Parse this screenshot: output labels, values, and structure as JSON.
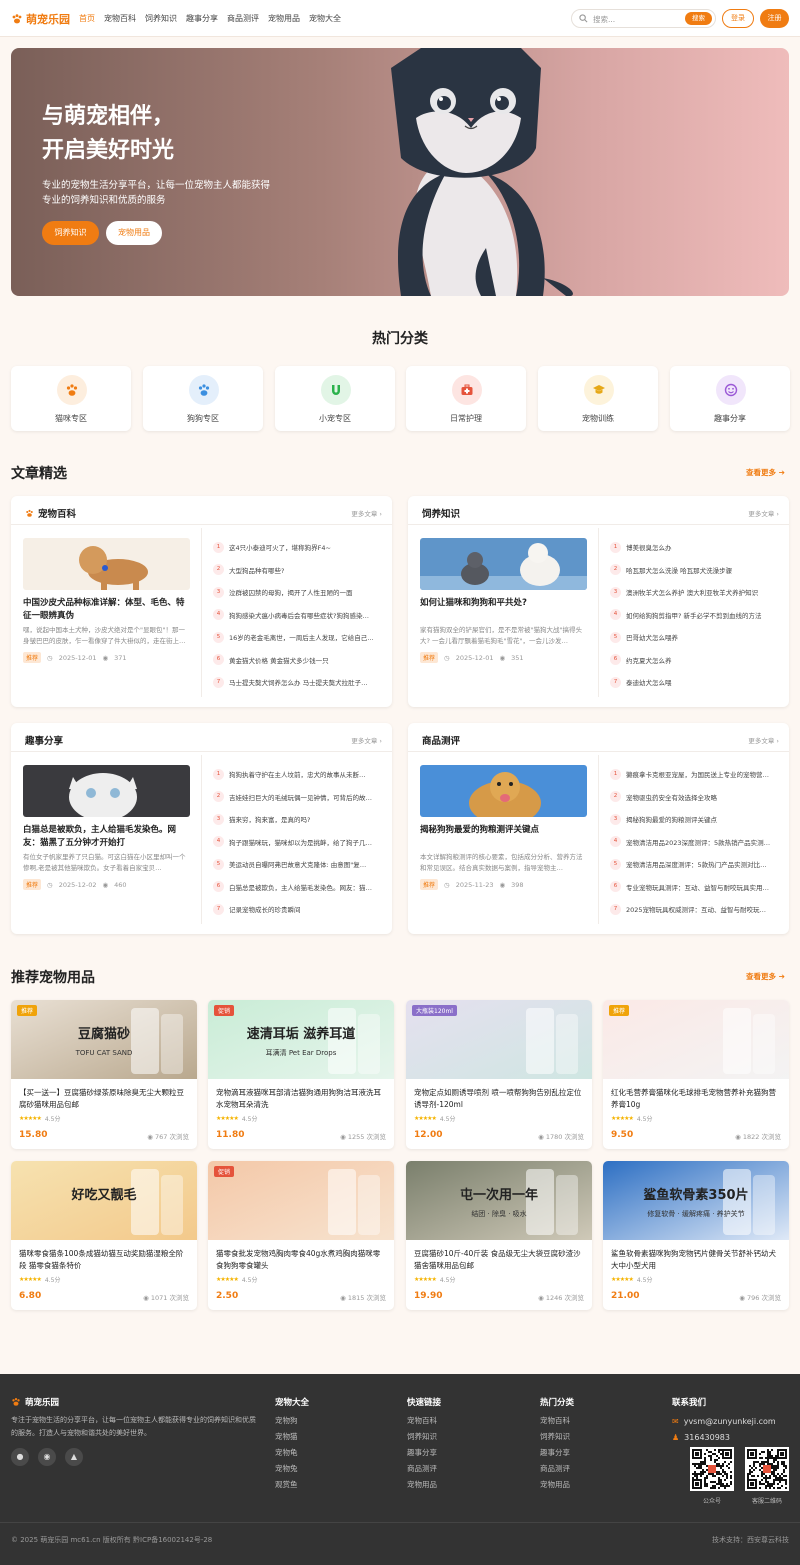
{
  "header": {
    "logo": "萌宠乐园",
    "nav": [
      "首页",
      "宠物百科",
      "饲养知识",
      "趣事分享",
      "商品测评",
      "宠物用品",
      "宠物大全"
    ],
    "search_placeholder": "搜索...",
    "search_button": "搜索",
    "login": "登录",
    "register": "注册"
  },
  "hero": {
    "title_line1": "与萌宠相伴，",
    "title_line2": "开启美好时光",
    "desc": "专业的宠物生活分享平台，让每一位宠物主人都能获得专业的饲养知识和优质的服务",
    "btn1": "饲养知识",
    "btn2": "宠物用品"
  },
  "categories": {
    "title": "热门分类",
    "items": [
      {
        "label": "猫咪专区",
        "icon": "paw-icon",
        "color": "#f07c12",
        "bg": "#fdeede"
      },
      {
        "label": "狗狗专区",
        "icon": "paw-icon",
        "color": "#3b8fe0",
        "bg": "#e4effb"
      },
      {
        "label": "小宠专区",
        "icon": "magnet-icon",
        "color": "#2bb24c",
        "bg": "#e2f5e6"
      },
      {
        "label": "日常护理",
        "icon": "medkit-icon",
        "color": "#e5533b",
        "bg": "#fde5e2"
      },
      {
        "label": "宠物训练",
        "icon": "graduation-icon",
        "color": "#e6a817",
        "bg": "#fdf3db"
      },
      {
        "label": "趣事分享",
        "icon": "smile-icon",
        "color": "#9b59d6",
        "bg": "#f1e6fb"
      }
    ]
  },
  "articles": {
    "title": "文章精选",
    "more": "查看更多",
    "panels": [
      {
        "title": "宠物百科",
        "more": "更多文章",
        "feature": {
          "title": "中国沙皮犬品种标准详解：体型、毛色、特征一眼辨真伪",
          "excerpt": "嘿，说起中国本土犬种，沙皮犬绝对是个\"显眼包\"！那一身皱巴巴的皮肤，乍一看像穿了件大褂似的，走在街上…",
          "tag": "推荐",
          "date": "2025-12-01",
          "views": "371"
        },
        "list": [
          "这4只小泰迪可火了，堪称狗界F4~",
          "大型狗品种有哪些?",
          "泣群被囚禁的母狗，揭开了人性丑陋的一面",
          "狗狗感染犬瘟小病毒后会有哪些症状?狗狗感染…",
          "16岁的老金毛离世，一周后主人发现，它给自己…",
          "黄金猫犬价格 黄金猫犬多少钱一只",
          "马士提夫獒犬饲养怎么办 马士提夫獒犬拉肚子…"
        ]
      },
      {
        "title": "饲养知识",
        "more": "更多文章",
        "feature": {
          "title": "如何让猫咪和狗狗和平共处?",
          "excerpt": "家有猫狗双全的铲屎官们，是不是常被\"猫狗大战\"搞得头大? 一会儿看厅飘着猫毛狗毛\"雪花\"，一会儿沙发…",
          "tag": "推荐",
          "date": "2025-12-01",
          "views": "351"
        },
        "list": [
          "博美很臭怎么办",
          "哈瓦那犬怎么洗澡 哈瓦那犬洗澡步骤",
          "澳洲牧羊犬怎么养护 澳大利亚牧羊犬养护知识",
          "如何给狗狗剪指甲? 新手必学不剪到血线的方法",
          "巴哥幼犬怎么喂养",
          "约克夏犬怎么养",
          "泰迪幼犬怎么喂"
        ]
      },
      {
        "title": "趣事分享",
        "more": "更多文章",
        "feature": {
          "title": "白猫总是被欺负，主人给猫毛发染色。网友：猫黑了五分钟才开始打",
          "excerpt": "有位女子帆家里养了只白猫。可这白猫在小区里却叫一个惨啊,老是被其他猫咪欺负。女子看着自家宝贝…",
          "tag": "推荐",
          "date": "2025-12-02",
          "views": "460"
        },
        "list": [
          "狗狗执着守护在主人坟前，忠犬的故事从未断…",
          "吉娃娃扫巨大的毛绒玩偶一见钟情，可背后的故…",
          "猫来穷，狗来富，是真的吗?",
          "狗子跟猫咪玩，猫咪却以为是挑衅，给了狗子几…",
          "美运动员自曝阿弗巴故意犬克隆体: 由意图\"复…",
          "白猫总是被欺负，主人给猫毛发染色。网友：猫…",
          "记录宠物成长的珍贵瞬间"
        ]
      },
      {
        "title": "商品测评",
        "more": "更多文章",
        "feature": {
          "title": "揭秘狗狗最爱的狗粮测评关键点",
          "excerpt": "本文详解狗粮测评的核心要素，包括成分分析、营养方法和常见误区。结合真实数据与案例，指导宠物主…",
          "tag": "推荐",
          "date": "2025-11-23",
          "views": "398"
        },
        "list": [
          "獭痕拿卡克根亚宠屋，为国民送上专业的宠物营…",
          "宠物驱虫药安全有效选择全攻略",
          "揭秘狗狗最爱的狗粮测评关键点",
          "宠物清洁用品2023深度测评：5款热销产品实测…",
          "宠物清洁用品深度测评：5款热门产品实测对比…",
          "专业宠物玩具测评：互动、益智与耐咬玩具实用…",
          "2025宠物玩具权威测评：互动、益智与耐咬玩…"
        ]
      }
    ]
  },
  "products": {
    "title": "推荐宠物用品",
    "more": "查看更多",
    "items": [
      {
        "name": "【买一送一】豆腐猫砂绿茶原味除臭无尘大颗粒豆腐砂猫咪用品包邮",
        "rating": "4.5分",
        "price": "15.80",
        "views": "767 次浏览",
        "badge": "推荐",
        "badge_color": "#f0a30a",
        "img_text": "豆腐猫砂",
        "img_sub": "TOFU CAT SAND",
        "bg1": "#e9e0d4",
        "bg2": "#b9a88e"
      },
      {
        "name": "宠物滴耳液猫咪耳部清洁猫狗通用狗狗洁耳液洗耳水宠物耳朵清洗",
        "rating": "4.5分",
        "price": "11.80",
        "views": "1255 次浏览",
        "badge": "促销",
        "badge_color": "#e5533b",
        "img_text": "速清耳垢 滋养耳道",
        "img_sub": "耳满清 Pet Ear Drops",
        "bg1": "#c9ecd6",
        "bg2": "#e6f5ec"
      },
      {
        "name": "宠物定点如厕诱导喷剂 喷一喷帮狗狗告别乱拉定位诱导剂-120ml",
        "rating": "4.5分",
        "price": "12.00",
        "views": "1780 次浏览",
        "badge": "大瓶装120ml",
        "badge_color": "#8a6fc9",
        "img_text": "",
        "img_sub": "",
        "bg1": "#e5e0ef",
        "bg2": "#cfe6e2"
      },
      {
        "name": "红化毛营养膏猫咪化毛球排毛宠物营养补充猫狗营养膏10g",
        "rating": "4.5分",
        "price": "9.50",
        "views": "1822 次浏览",
        "badge": "推荐",
        "badge_color": "#f0a30a",
        "img_text": "",
        "img_sub": "",
        "bg1": "#fbe9e6",
        "bg2": "#f3f3f3"
      },
      {
        "name": "猫咪零食猫条100条成猫幼猫互动奖励猫湿粮全阶段 猫零食猫条特价",
        "rating": "4.5分",
        "price": "6.80",
        "views": "1071 次浏览",
        "badge": "",
        "badge_color": "#f0a30a",
        "img_text": "好吃又靓毛",
        "img_sub": "",
        "bg1": "#f6e2b0",
        "bg2": "#f3c98b"
      },
      {
        "name": "猫零食批发宠物鸡胸肉零食40g水煮鸡胸肉猫咪零食狗狗零食罐头",
        "rating": "4.5分",
        "price": "2.50",
        "views": "1815 次浏览",
        "badge": "促销",
        "badge_color": "#e5533b",
        "img_text": "",
        "img_sub": "",
        "bg1": "#f4c8a8",
        "bg2": "#f7e3cf"
      },
      {
        "name": "豆腐猫砂10斤-40斤装 食品级无尘大袋豆腐砂渣沙猫舍猫咪用品包邮",
        "rating": "4.5分",
        "price": "19.90",
        "views": "1246 次浏览",
        "badge": "",
        "badge_color": "#f0a30a",
        "img_text": "屯一次用一年",
        "img_sub": "结团 · 除臭 · 吸水",
        "bg1": "#7a7f6c",
        "bg2": "#cfc9b8"
      },
      {
        "name": "鲨鱼软骨素猫咪狗狗宠物钙片健骨关节舒补钙幼犬大中小型犬用",
        "rating": "4.5分",
        "price": "21.00",
        "views": "796 次浏览",
        "badge": "",
        "badge_color": "#f0a30a",
        "img_text": "鲨鱼软骨素350片",
        "img_sub": "修复软骨 · 缓解疼痛 · 养护关节",
        "bg1": "#2d6fc3",
        "bg2": "#dfe9f7"
      }
    ]
  },
  "footer": {
    "logo": "萌宠乐园",
    "desc": "专注于宠物生活的分享平台，让每一位宠物主人都能获得专业的饲养知识和优质的服务。打造人与宠物和谐共处的美好世界。",
    "cols": [
      {
        "title": "宠物大全",
        "links": [
          "宠物狗",
          "宠物猫",
          "宠物龟",
          "宠物兔",
          "观赏鱼"
        ]
      },
      {
        "title": "快速链接",
        "links": [
          "宠物百科",
          "饲养知识",
          "趣事分享",
          "商品测评",
          "宠物用品"
        ]
      },
      {
        "title": "热门分类",
        "links": [
          "宠物百科",
          "饲养知识",
          "趣事分享",
          "商品测评",
          "宠物用品"
        ]
      }
    ],
    "contact_title": "联系我们",
    "email": "yvsm@zunyunkeji.com",
    "qq": "316430983",
    "qr1": "公众号",
    "qr2": "客服二维码",
    "copyright": "© 2025 萌宠乐园 mc61.cn 版权所有 黔ICP备16002142号-28",
    "support": "技术支持：西安尊云科技"
  }
}
